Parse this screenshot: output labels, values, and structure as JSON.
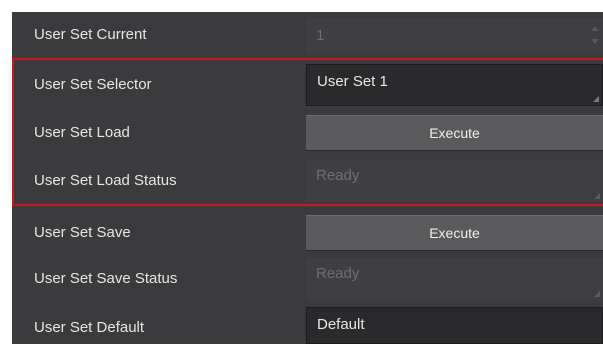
{
  "rows": [
    {
      "label": "User Set Current",
      "value": "1",
      "kind": "spinner",
      "enabled": false
    },
    {
      "label": "User Set Selector",
      "value": "User Set 1",
      "kind": "select",
      "enabled": true
    },
    {
      "label": "User Set Load",
      "value": "Execute",
      "kind": "button",
      "enabled": true
    },
    {
      "label": "User Set Load Status",
      "value": "Ready",
      "kind": "readonly",
      "enabled": false
    },
    {
      "label": "User Set Save",
      "value": "Execute",
      "kind": "button",
      "enabled": true
    },
    {
      "label": "User Set Save Status",
      "value": "Ready",
      "kind": "readonly",
      "enabled": false
    },
    {
      "label": "User Set Default",
      "value": "Default",
      "kind": "select",
      "enabled": true
    }
  ],
  "highlight": {
    "color": "#d0161b",
    "covers": [
      "User Set Selector",
      "User Set Load",
      "User Set Load Status"
    ]
  },
  "colors": {
    "panel_background": "#3b3b3d",
    "text": "#e6e6e6",
    "disabled_text": "#6e6e70",
    "button_background": "#5a5a5c",
    "select_background": "#2a2a2c"
  }
}
